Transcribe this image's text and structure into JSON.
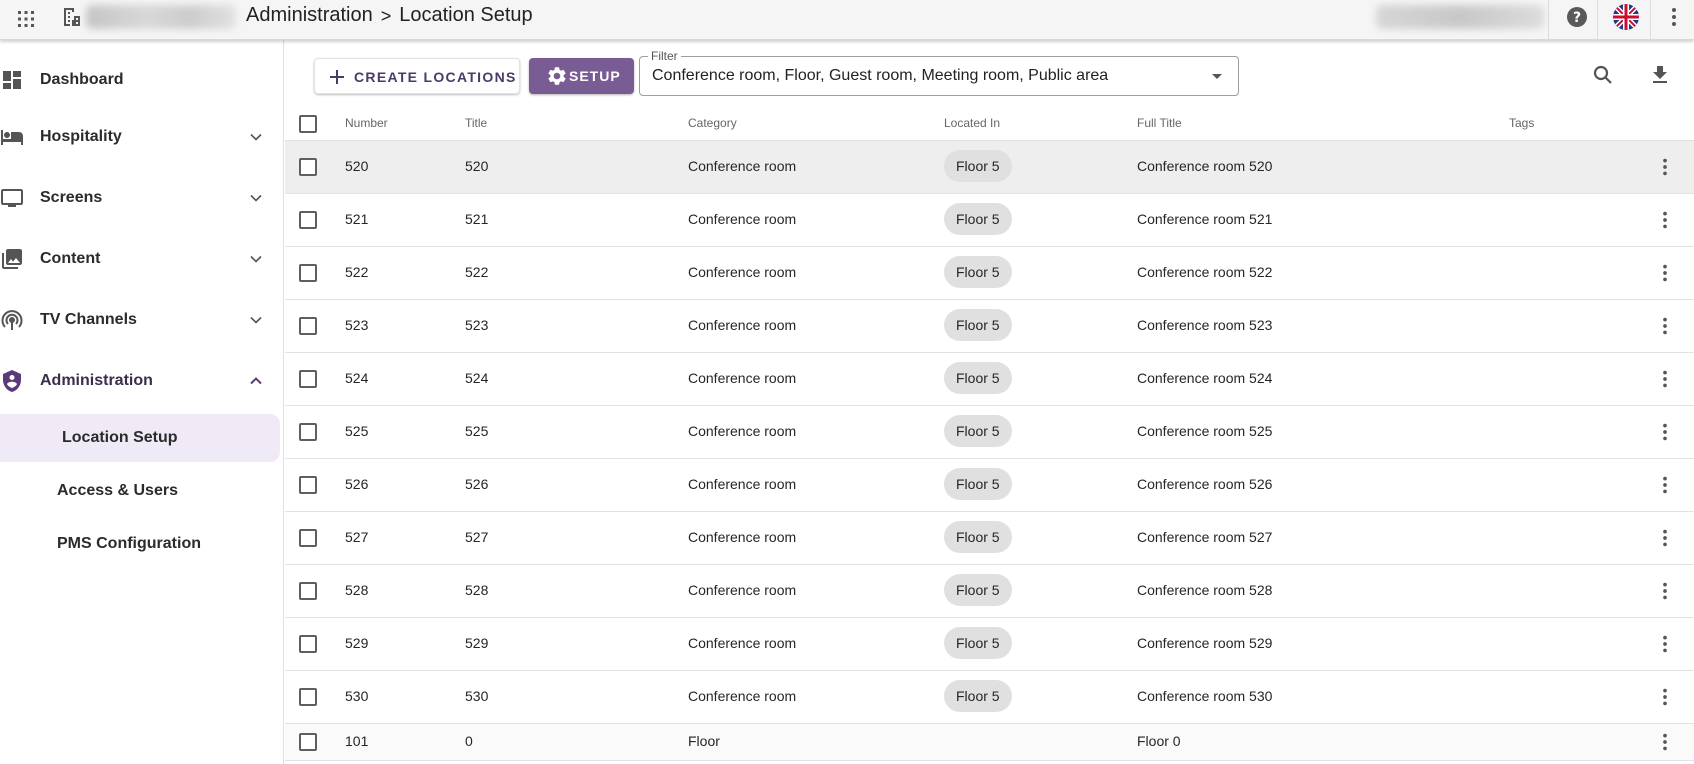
{
  "topbar": {
    "breadcrumb_parent": "Administration",
    "breadcrumb_separator": ">",
    "breadcrumb_current": "Location Setup",
    "icons": [
      "apps-grid-icon",
      "hotel-building-icon",
      "help-icon",
      "uk-flag-icon",
      "more-vert-icon"
    ]
  },
  "sidebar": {
    "items": [
      {
        "label": "Dashboard",
        "icon": "dashboard-icon"
      },
      {
        "label": "Hospitality",
        "icon": "bed-icon"
      },
      {
        "label": "Screens",
        "icon": "monitor-icon"
      },
      {
        "label": "Content",
        "icon": "photo-library-icon"
      },
      {
        "label": "TV Channels",
        "icon": "broadcast-icon"
      },
      {
        "label": "Administration",
        "icon": "admin-shield-icon"
      }
    ],
    "subitems": [
      {
        "label": "Location Setup",
        "selected": true
      },
      {
        "label": "Access & Users",
        "selected": false
      },
      {
        "label": "PMS Configuration",
        "selected": false
      }
    ]
  },
  "toolbar": {
    "create_label": "CREATE LOCATIONS",
    "setup_label": "SETUP",
    "filter_label": "Filter",
    "filter_value": "Conference room, Floor, Guest room, Meeting room, Public area"
  },
  "colors": {
    "accent": "#7a5c94",
    "accent_dark": "#4a3a66",
    "selected_nav_bg": "#efeaf6",
    "chip_bg": "#e0e0e0"
  },
  "table": {
    "columns": [
      "Number",
      "Title",
      "Category",
      "Located In",
      "Full Title",
      "Tags"
    ],
    "rows": [
      {
        "number": "520",
        "title": "520",
        "category": "Conference room",
        "located_in": "Floor 5",
        "full_title": "Conference room 520"
      },
      {
        "number": "521",
        "title": "521",
        "category": "Conference room",
        "located_in": "Floor 5",
        "full_title": "Conference room 521"
      },
      {
        "number": "522",
        "title": "522",
        "category": "Conference room",
        "located_in": "Floor 5",
        "full_title": "Conference room 522"
      },
      {
        "number": "523",
        "title": "523",
        "category": "Conference room",
        "located_in": "Floor 5",
        "full_title": "Conference room 523"
      },
      {
        "number": "524",
        "title": "524",
        "category": "Conference room",
        "located_in": "Floor 5",
        "full_title": "Conference room 524"
      },
      {
        "number": "525",
        "title": "525",
        "category": "Conference room",
        "located_in": "Floor 5",
        "full_title": "Conference room 525"
      },
      {
        "number": "526",
        "title": "526",
        "category": "Conference room",
        "located_in": "Floor 5",
        "full_title": "Conference room 526"
      },
      {
        "number": "527",
        "title": "527",
        "category": "Conference room",
        "located_in": "Floor 5",
        "full_title": "Conference room 527"
      },
      {
        "number": "528",
        "title": "528",
        "category": "Conference room",
        "located_in": "Floor 5",
        "full_title": "Conference room 528"
      },
      {
        "number": "529",
        "title": "529",
        "category": "Conference room",
        "located_in": "Floor 5",
        "full_title": "Conference room 529"
      },
      {
        "number": "530",
        "title": "530",
        "category": "Conference room",
        "located_in": "Floor 5",
        "full_title": "Conference room 530"
      },
      {
        "number": "101",
        "title": "0",
        "category": "Floor",
        "located_in": "",
        "full_title": "Floor 0"
      }
    ]
  }
}
